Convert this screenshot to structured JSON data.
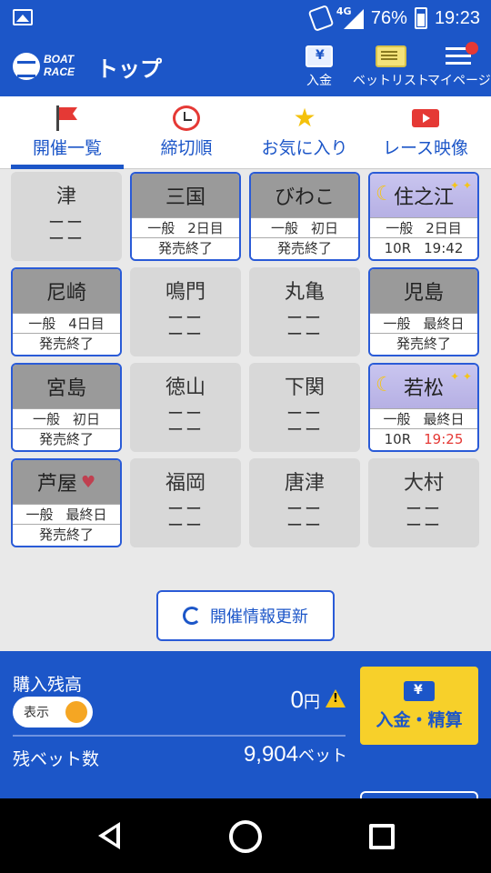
{
  "status_bar": {
    "network": "4G",
    "battery": "76%",
    "time": "19:23"
  },
  "app_bar": {
    "logo_line1": "BOAT",
    "logo_line2": "RACE",
    "title": "トップ",
    "buttons": [
      {
        "label": "入金",
        "icon": "deposit-icon"
      },
      {
        "label": "ベットリスト",
        "icon": "betlist-icon"
      },
      {
        "label": "マイページ",
        "icon": "menu-icon"
      }
    ]
  },
  "tabs": [
    {
      "label": "開催一覧",
      "icon": "flag-icon",
      "active": true
    },
    {
      "label": "締切順",
      "icon": "alarm-clock-icon"
    },
    {
      "label": "お気に入り",
      "icon": "star-icon",
      "star": "★"
    },
    {
      "label": "レース映像",
      "icon": "video-icon"
    }
  ],
  "venues": [
    {
      "name": "津",
      "state": "off",
      "dash": "ーー"
    },
    {
      "name": "三国",
      "state": "on",
      "grade": "一般",
      "day": "2日目",
      "status": "発売終了"
    },
    {
      "name": "びわこ",
      "state": "on",
      "grade": "一般",
      "day": "初日",
      "status": "発売終了"
    },
    {
      "name": "住之江",
      "state": "night",
      "grade": "一般",
      "day": "2日目",
      "race": "10R",
      "time": "19:42",
      "moon": "☾",
      "stars": "✦ ✦"
    },
    {
      "name": "尼崎",
      "state": "on",
      "grade": "一般",
      "day": "4日目",
      "status": "発売終了"
    },
    {
      "name": "鳴門",
      "state": "off",
      "dash": "ーー"
    },
    {
      "name": "丸亀",
      "state": "off",
      "dash": "ーー"
    },
    {
      "name": "児島",
      "state": "on",
      "grade": "一般",
      "day": "最終日",
      "status": "発売終了"
    },
    {
      "name": "宮島",
      "state": "on",
      "grade": "一般",
      "day": "初日",
      "status": "発売終了"
    },
    {
      "name": "徳山",
      "state": "off",
      "dash": "ーー"
    },
    {
      "name": "下関",
      "state": "off",
      "dash": "ーー"
    },
    {
      "name": "若松",
      "state": "night",
      "grade": "一般",
      "day": "最終日",
      "race": "10R",
      "time": "19:25",
      "moon": "☾",
      "stars": "✦ ✦"
    },
    {
      "name": "芦屋",
      "state": "on",
      "grade": "一般",
      "day": "最終日",
      "status": "発売終了",
      "heart": "♥"
    },
    {
      "name": "福岡",
      "state": "off",
      "dash": "ーー"
    },
    {
      "name": "唐津",
      "state": "off",
      "dash": "ーー"
    },
    {
      "name": "大村",
      "state": "off",
      "dash": "ーー"
    }
  ],
  "refresh_label": "開催情報更新",
  "panel": {
    "balance_label": "購入残高",
    "toggle_label": "表示",
    "balance_value": "0",
    "balance_unit": "円",
    "remaining_label": "残ベット数",
    "remaining_value": "9,904",
    "remaining_unit": "ベット",
    "deposit_button": "入金・精算"
  }
}
